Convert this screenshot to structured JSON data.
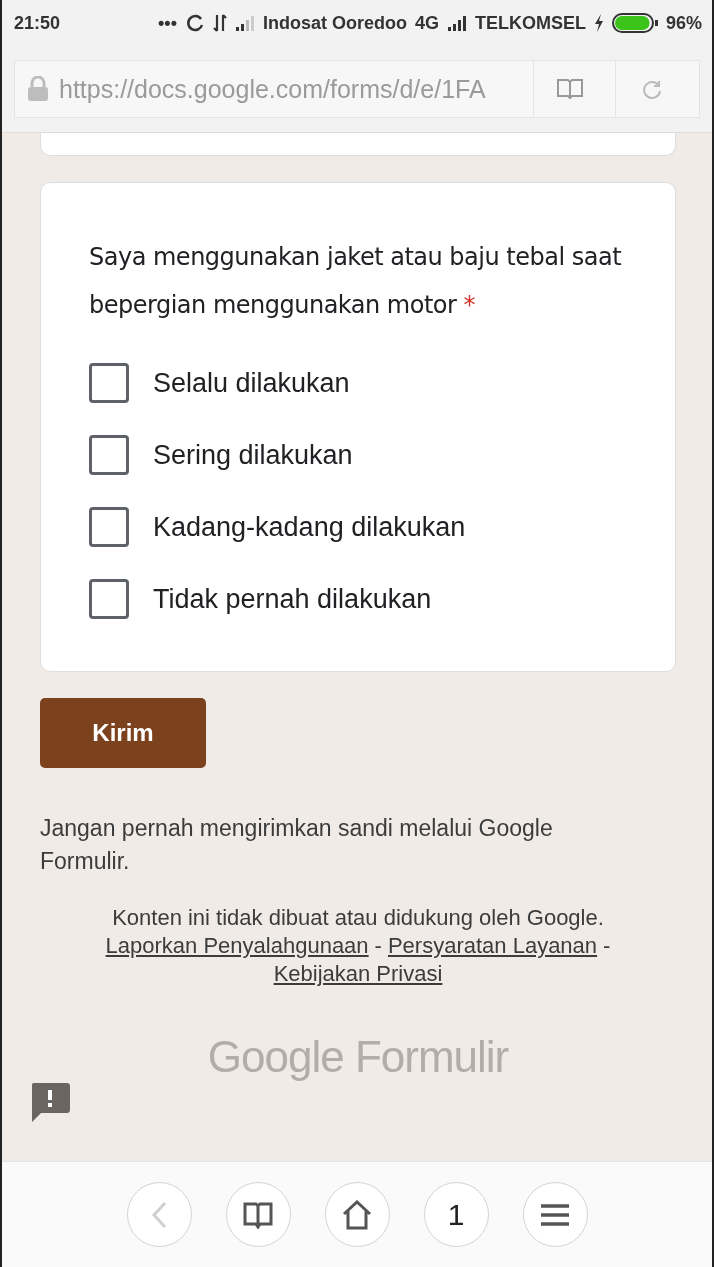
{
  "status_bar": {
    "time": "21:50",
    "dots": "•••",
    "carrier_1": "Indosat Ooredoo",
    "network": "4G",
    "carrier_2": "TELKOMSEL",
    "battery": {
      "level": 0.96,
      "label": "96%"
    }
  },
  "address_bar": {
    "url": "https://docs.google.com/forms/d/e/1FA"
  },
  "question": {
    "title": "Saya menggunakan jaket atau baju tebal saat bepergian menggunakan motor",
    "required_mark": "*",
    "options": [
      {
        "label": "Selalu dilakukan",
        "checked": false
      },
      {
        "label": "Sering dilakukan",
        "checked": false
      },
      {
        "label": "Kadang-kadang dilakukan",
        "checked": false
      },
      {
        "label": "Tidak pernah dilakukan",
        "checked": false
      }
    ]
  },
  "submit_button": "Kirim",
  "password_warning": "Jangan pernah mengirimkan sandi melalui Google Formulir.",
  "disclaimer": "Konten ini tidak dibuat atau didukung oleh Google.",
  "links": [
    {
      "label": "Laporkan Penyalahgunaan"
    },
    {
      "label": "Persyaratan Layanan"
    },
    {
      "label": "Kebijakan Privasi"
    }
  ],
  "link_separator": "-",
  "logo": {
    "brand": "Google",
    "product": "Formulir"
  },
  "bottom_nav": [
    {
      "kind": "back",
      "disabled": true
    },
    {
      "kind": "bookmarks",
      "disabled": false
    },
    {
      "kind": "home",
      "disabled": false
    },
    {
      "kind": "tabs",
      "label": "1",
      "disabled": false
    },
    {
      "kind": "menu",
      "disabled": false
    }
  ]
}
